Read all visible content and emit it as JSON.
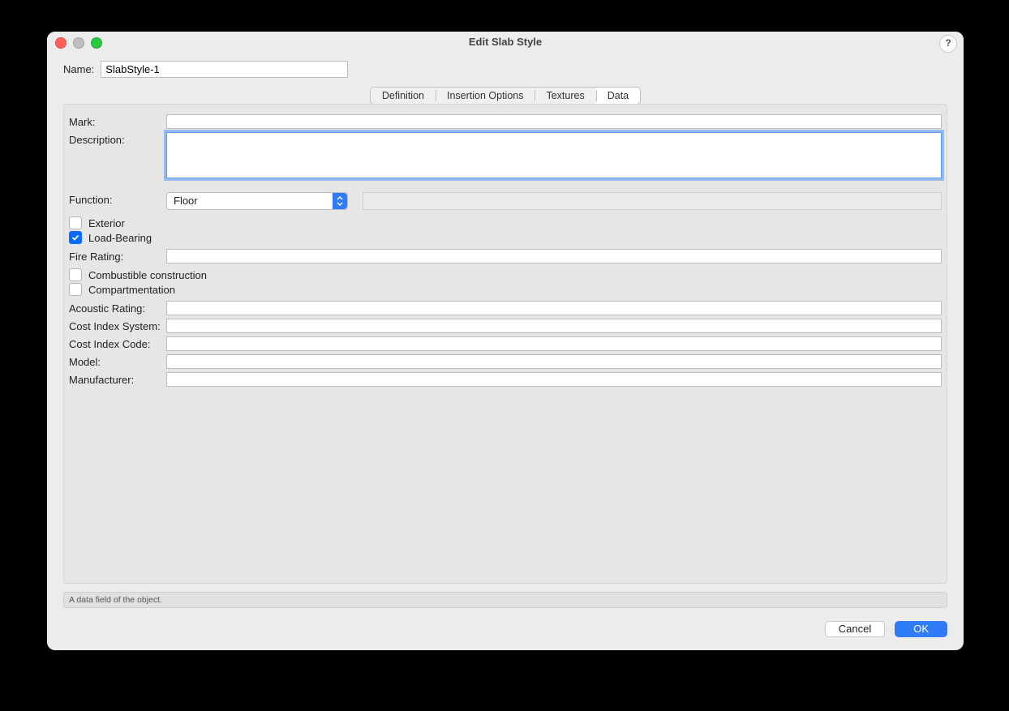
{
  "window": {
    "title": "Edit Slab Style",
    "help": "?"
  },
  "name_row": {
    "label": "Name:",
    "value": "SlabStyle-1"
  },
  "tabs": [
    {
      "label": "Definition",
      "active": false
    },
    {
      "label": "Insertion Options",
      "active": false
    },
    {
      "label": "Textures",
      "active": false
    },
    {
      "label": "Data",
      "active": true
    }
  ],
  "fields": {
    "mark": {
      "label": "Mark:",
      "value": ""
    },
    "description": {
      "label": "Description:",
      "value": ""
    },
    "function": {
      "label": "Function:",
      "value": "Floor"
    },
    "exterior": {
      "label": "Exterior",
      "checked": false
    },
    "load_bearing": {
      "label": "Load-Bearing",
      "checked": true
    },
    "fire_rating": {
      "label": "Fire Rating:",
      "value": ""
    },
    "combustible": {
      "label": "Combustible construction",
      "checked": false
    },
    "compartmentation": {
      "label": "Compartmentation",
      "checked": false
    },
    "acoustic_rating": {
      "label": "Acoustic Rating:",
      "value": ""
    },
    "cost_index_system": {
      "label": "Cost Index System:",
      "value": ""
    },
    "cost_index_code": {
      "label": "Cost Index Code:",
      "value": ""
    },
    "model": {
      "label": "Model:",
      "value": ""
    },
    "manufacturer": {
      "label": "Manufacturer:",
      "value": ""
    }
  },
  "status_text": "A data field of the object.",
  "buttons": {
    "cancel": "Cancel",
    "ok": "OK"
  }
}
